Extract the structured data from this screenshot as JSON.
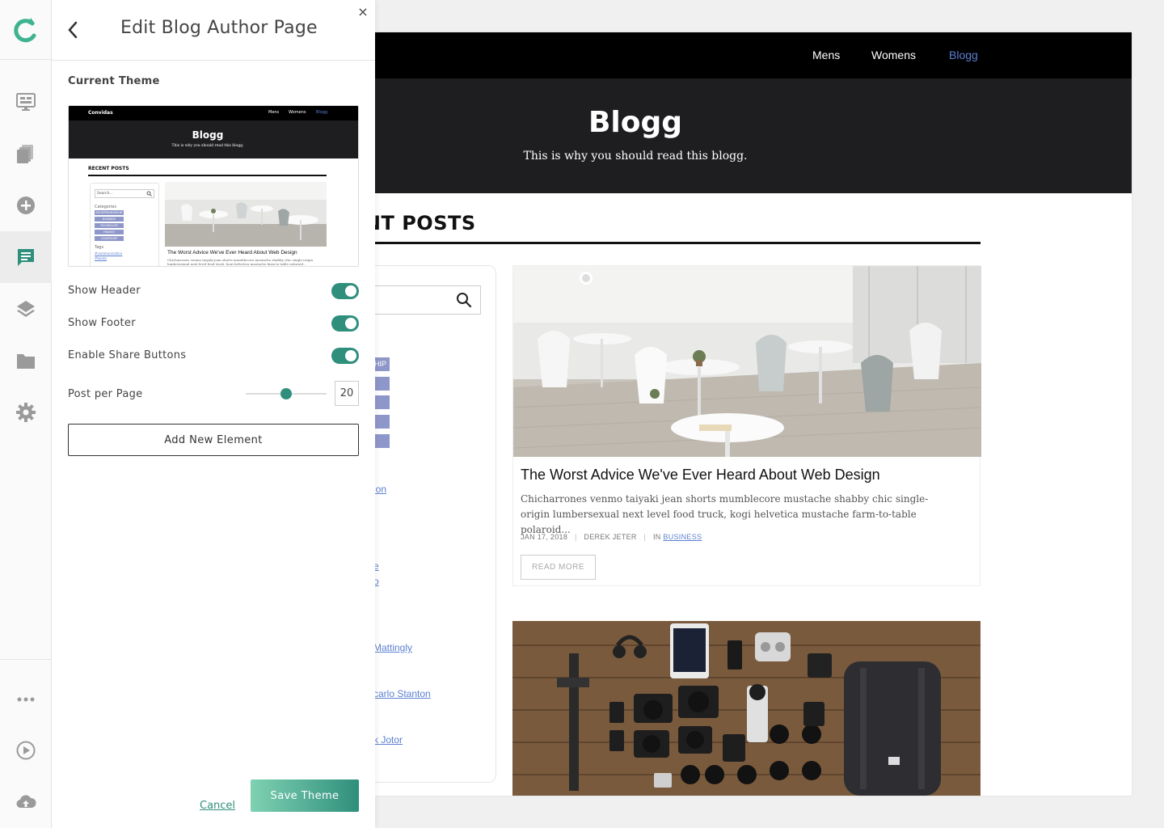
{
  "panel": {
    "title": "Edit Blog Author Page",
    "close_glyph": "×",
    "current_theme_label": "Current Theme",
    "options": [
      {
        "label": "Show Header",
        "enabled": true
      },
      {
        "label": "Show Footer",
        "enabled": true
      },
      {
        "label": "Enable Share Buttons",
        "enabled": true
      }
    ],
    "posts_per_page_label": "Post per Page",
    "posts_per_page_value": "20",
    "add_element_label": "Add New Element",
    "cancel_label": "Cancel",
    "save_label": "Save Theme"
  },
  "thumbnail": {
    "brand": "Convidas",
    "nav": [
      "Mens",
      "Womens",
      "Blogg"
    ],
    "title": "Blogg",
    "subtitle": "This is why you should read this blogg.",
    "section": "RECENT POSTS",
    "search_placeholder": "Search...",
    "categories_label": "Categories",
    "categories": [
      "ENTREPRENEURSHIP",
      "BUSINESS",
      "TECHNOLOGY",
      "FINANCE",
      "LEADERSHIP"
    ],
    "tags_label": "Tags",
    "tags": [
      "#communication",
      "#books"
    ],
    "post_title": "The Worst Advice We've Ever Heard About Web Design",
    "post_excerpt": "Chicharrones venmo taiyaki jean shorts mumblecore mustache shabby chic single-origin lumbersexual next level food truck, kogi helvetica mustache farm-to-table polaroid..."
  },
  "preview": {
    "nav": [
      "Mens",
      "Womens",
      "Blogg"
    ],
    "title": "Blogg",
    "subtitle": "This is why you should read this blogg.",
    "section": "POSTS",
    "categories": [
      "HIP",
      "",
      "",
      "",
      ""
    ],
    "side_links": [
      "ion",
      "e",
      "o",
      "Mattingly",
      "carlo Stanton",
      "k Jotor"
    ],
    "post": {
      "title": "The Worst Advice We've Ever Heard About Web Design",
      "excerpt": "Chicharrones venmo taiyaki jean shorts mumblecore mustache shabby chic single-origin lumbersexual next level food truck, kogi helvetica mustache farm-to-table polaroid...",
      "date": "JAN 17, 2018",
      "author": "DEREK JETER",
      "in_label": "IN",
      "category": "BUSINESS",
      "read_more": "READ MORE"
    }
  },
  "rail": {
    "items": [
      "monitor-icon",
      "pages-icon",
      "add-icon",
      "blog-icon",
      "layers-icon",
      "folder-icon",
      "settings-icon",
      "more-icon",
      "play-icon",
      "cloud-upload-icon"
    ],
    "active": "blog-icon"
  },
  "colors": {
    "accent": "#2f8f7c",
    "nav_active": "#5b7fd1",
    "hero_bg": "#1e1e21",
    "category_bg": "#8e97c9"
  }
}
